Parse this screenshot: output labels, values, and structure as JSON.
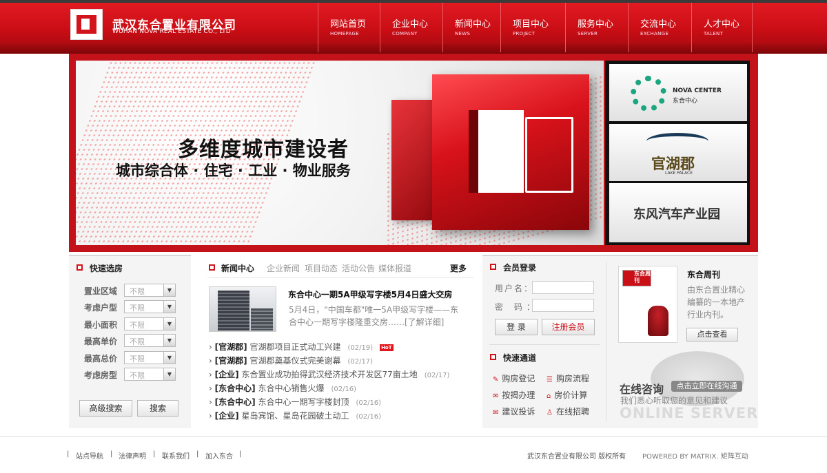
{
  "header": {
    "company_cn": "武汉东合置业有限公司",
    "company_en": "WUHAN NOVA REAL ESTATE CO., LTD",
    "nav": [
      {
        "cn": "网站首页",
        "en": "HOMEPAGE"
      },
      {
        "cn": "企业中心",
        "en": "COMPANY"
      },
      {
        "cn": "新闻中心",
        "en": "NEWS"
      },
      {
        "cn": "项目中心",
        "en": "PROJECT"
      },
      {
        "cn": "服务中心",
        "en": "SERVER"
      },
      {
        "cn": "交流中心",
        "en": "EXCHANGE"
      },
      {
        "cn": "人才中心",
        "en": "TALENT"
      }
    ]
  },
  "banner": {
    "title": "多维度城市建设者",
    "subtitle": "城市综合体 · 住宅 · 工业 · 物业服务",
    "projects": [
      {
        "name_en": "NOVA CENTER",
        "name_cn": "东合中心"
      },
      {
        "name_cn": "官湖郡",
        "name_en": "LAKE PALACE"
      },
      {
        "name_cn": "东风汽车产业园"
      }
    ]
  },
  "quick_search": {
    "title": "快速选房",
    "fields": [
      {
        "label": "置业区域",
        "value": "不限"
      },
      {
        "label": "考虑户型",
        "value": "不限"
      },
      {
        "label": "最小面积",
        "value": "不限"
      },
      {
        "label": "最高单价",
        "value": "不限"
      },
      {
        "label": "最高总价",
        "value": "不限"
      },
      {
        "label": "考虑房型",
        "value": "不限"
      }
    ],
    "advanced_label": "高级搜索",
    "search_label": "搜索"
  },
  "news": {
    "title": "新闻中心",
    "tabs": [
      "企业新闻",
      "项目动态",
      "活动公告",
      "媒体报道"
    ],
    "more": "更多",
    "headline": "东合中心一期5A甲级写字楼5月4日盛大交房",
    "summary": "5月4日，\"中国车都\"唯一5A甲级写字楼——东合中心一期写字楼隆重交房……[了解详细]",
    "items": [
      {
        "tag": "[官湖郡]",
        "text": "官湖郡项目正式动工兴建",
        "date": "(02/19)",
        "hot": "HoT"
      },
      {
        "tag": "[官湖郡]",
        "text": "官湖郡奠基仪式完美谢幕",
        "date": "(02/17)"
      },
      {
        "tag": "[企业]",
        "text": "东合置业成功拍得武汉经济技术开发区77亩土地",
        "date": "(02/17)"
      },
      {
        "tag": "[东合中心]",
        "text": "东合中心销售火爆",
        "date": "(02/16)"
      },
      {
        "tag": "[东合中心]",
        "text": "东合中心一期写字楼封顶",
        "date": "(02/16)"
      },
      {
        "tag": "[企业]",
        "text": "星岛宾馆、星岛花园破土动工",
        "date": "(02/16)"
      }
    ]
  },
  "member": {
    "title": "会员登录",
    "username_label": "用户名：",
    "password_label": "密  码：",
    "login_label": "登 录",
    "register_label": "注册会员"
  },
  "quick_links": {
    "title": "快速通道",
    "items": [
      "购房登记",
      "购房流程",
      "按揭办理",
      "房价计算",
      "建议投诉",
      "在线招聘"
    ]
  },
  "magazine": {
    "logo": "东合周刊",
    "title": "东合周刊",
    "desc": "由东合置业精心编纂的一本地产行业内刊。",
    "button": "点击查看"
  },
  "online": {
    "title": "在线咨询",
    "button": "点击立即在线沟通",
    "subtitle": "我们悉心听取您的意见和建议",
    "english": "ONLINE SERVER"
  },
  "footer": {
    "links": [
      "站点导航",
      "法律声明",
      "联系我们",
      "加入东合"
    ],
    "copyright": "武汉东合置业有限公司  版权所有",
    "powered": "POWERED BY MATRIX. 矩阵互动"
  },
  "colors": {
    "brand_red": "#d0121a",
    "header_red": "#e21a22"
  }
}
